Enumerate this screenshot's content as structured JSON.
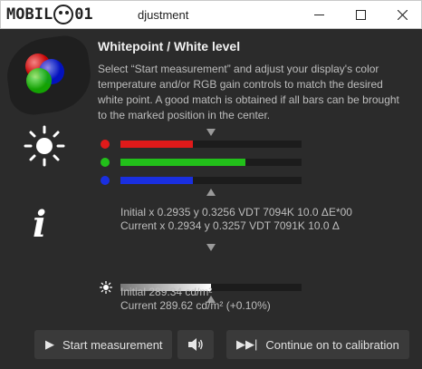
{
  "window": {
    "logo_text": "MOBILE01",
    "title_suffix": "djustment",
    "minimize_icon": "minimize-icon",
    "maximize_icon": "maximize-icon",
    "close_icon": "close-icon"
  },
  "heading": "Whitepoint / White level",
  "description": "Select “Start measurement” and adjust your display's color temperature and/or RGB gain controls to match the desired white point. A good match is obtained if all bars can be brought to the marked position in the center.",
  "rgb_bars": [
    {
      "name": "red",
      "color": "#e01a1a",
      "fill_fraction": 0.4
    },
    {
      "name": "green",
      "color": "#22c01a",
      "fill_fraction": 0.69
    },
    {
      "name": "blue",
      "color": "#1a2fe0",
      "fill_fraction": 0.4
    }
  ],
  "whitepoint": {
    "initial": "Initial x 0.2935 y 0.3256 VDT 7094K 10.0 ΔE*00",
    "current": "Current x 0.2934 y 0.3257 VDT 7091K 10.0 Δ"
  },
  "luminance": {
    "fill_fraction": 0.5,
    "initial": "Initial 289.34 cd/m²",
    "current": "Current 289.62 cd/m² (+0.10%)"
  },
  "buttons": {
    "start": "Start measurement",
    "sound_icon": "speaker-icon",
    "continue": "Continue on to calibration"
  }
}
